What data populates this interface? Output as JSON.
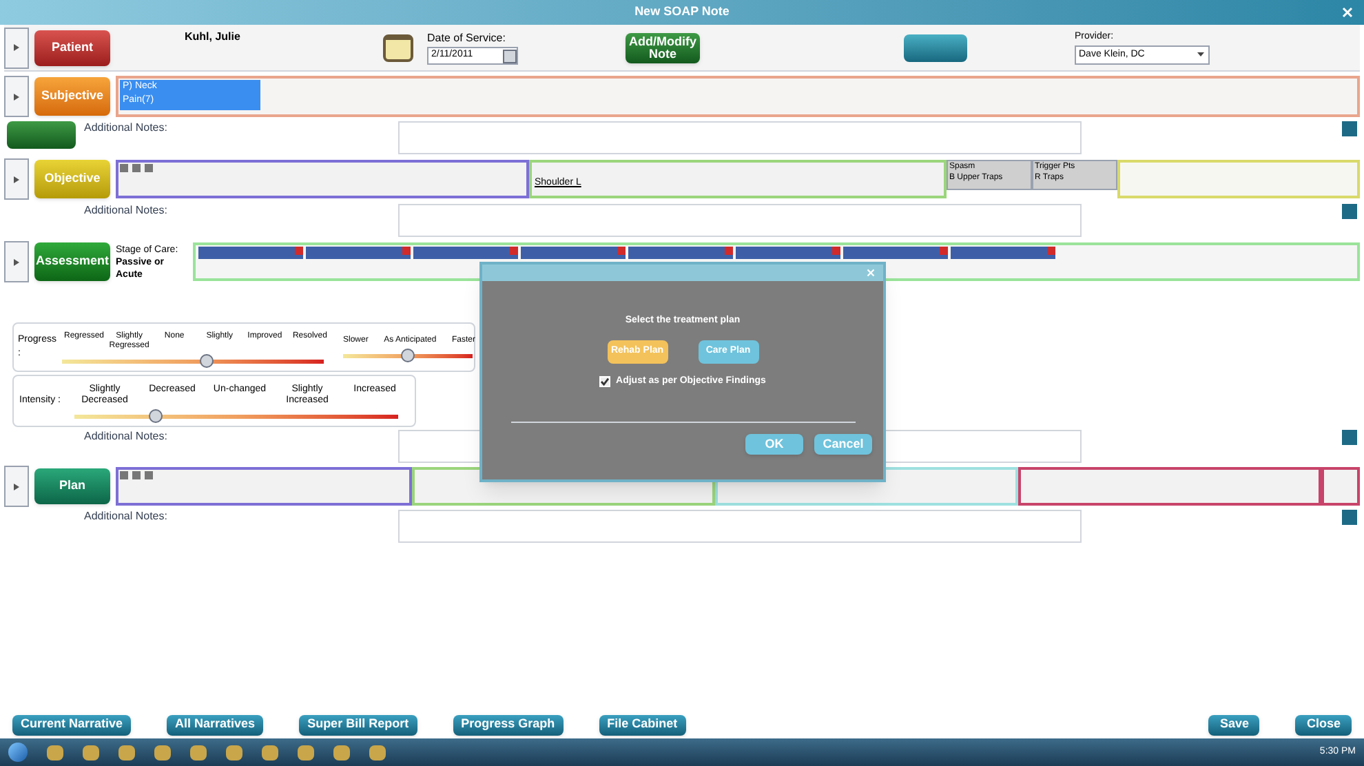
{
  "window": {
    "title": "New SOAP Note"
  },
  "patient": {
    "button": "Patient",
    "name": "Kuhl, Julie",
    "date_label": "Date of Service:",
    "date": "2/11/2011",
    "add_note": "Add/Modify Note",
    "provider_label": "Provider:",
    "provider": "Dave Klein, DC"
  },
  "subjective": {
    "button": "Subjective",
    "complaints": [
      "P) Neck",
      "Pain(7)"
    ]
  },
  "notes_labels": [
    "Additional Notes:",
    "Additional Notes:",
    "Additional Notes:",
    "Additional Notes:"
  ],
  "objective": {
    "button": "Objective",
    "finding": "Shoulder L",
    "columns": [
      {
        "title": "Spasm",
        "value": "B Upper Traps"
      },
      {
        "title": "Trigger Pts",
        "value": "R Traps"
      }
    ]
  },
  "assessment": {
    "button": "Assessment",
    "stage_label": "Stage of Care:",
    "stage": "Passive or Acute"
  },
  "progress": {
    "label": "Progress :",
    "marks": [
      "Regressed",
      "Slightly Regressed",
      "None",
      "Slightly",
      "Improved",
      "Resolved"
    ],
    "level": 0.55,
    "pace": {
      "marks": [
        "Slower",
        "As Anticipated",
        "Faster"
      ],
      "level": 0.5
    }
  },
  "intensity": {
    "label": "Intensity :",
    "marks": [
      "Slightly Decreased",
      "Decreased",
      "Un-changed",
      "Slightly Increased",
      "Increased"
    ],
    "level": 0.25
  },
  "plan": {
    "button": "Plan"
  },
  "dialog": {
    "prompt": "Select the treatment plan",
    "options": [
      {
        "label": "Rehab Plan",
        "selected": true
      },
      {
        "label": "Care Plan",
        "selected": false
      }
    ],
    "adjust": {
      "label": "Adjust as per Objective Findings",
      "checked": true
    },
    "buttons": [
      "OK",
      "Cancel"
    ]
  },
  "footer": {
    "left": [
      "Current Narrative",
      "All Narratives",
      "Super Bill Report",
      "Progress Graph",
      "File Cabinet"
    ],
    "right": [
      "Save",
      "Close"
    ]
  },
  "taskbar": {
    "time": "5:30 PM"
  }
}
